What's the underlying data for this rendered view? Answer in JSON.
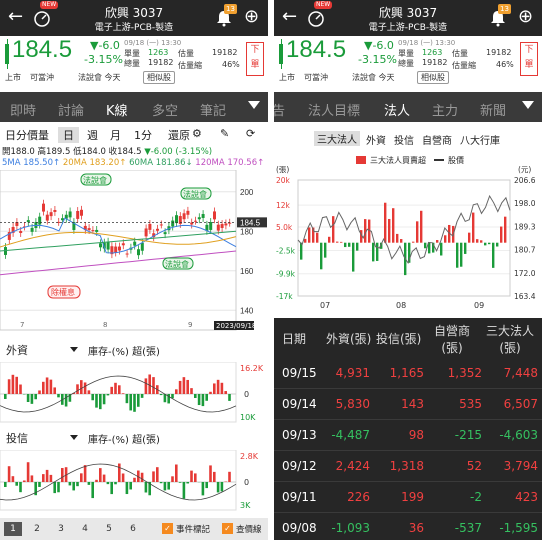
{
  "stock": {
    "name": "欣興 3037",
    "sector": "電子上游-PCB-製造",
    "price": "184.5",
    "change": "▼-6.0",
    "change_pct": "-3.15%",
    "time": "09/18 (一) 13:30",
    "unit_vol_label": "單量",
    "unit_vol": "1263",
    "total_vol_label": "總量",
    "total_vol": "19182",
    "est_vol_label": "估量",
    "est_vol": "19182",
    "est_vol_pct_label": "估量縮",
    "est_vol_pct": "46%",
    "sell_label": "下單",
    "notif_count": "13",
    "new_badge": "NEW"
  },
  "tags": {
    "market": "上市",
    "margin": "可當沖",
    "event": "法說會 今天",
    "similar": "相似股"
  },
  "left": {
    "tabs": [
      "即時",
      "討論",
      "K線",
      "多空",
      "筆記"
    ],
    "period": {
      "days_vol": "日分價量",
      "day": "日",
      "week": "週",
      "month": "月",
      "minute": "1分",
      "restore": "還原"
    },
    "ohlc": {
      "open": "開188.0",
      "high": "高189.5",
      "low": "低184.0",
      "close": "收184.5",
      "chg": "▼-6.00",
      "pct": "(-3.15%)"
    },
    "ma": [
      {
        "label": "5MA 185.50↑",
        "color": "#3d7fe0"
      },
      {
        "label": "20MA 183.20↑",
        "color": "#e0a020"
      },
      {
        "label": "60MA 181.86↓",
        "color": "#30a060"
      },
      {
        "label": "120MA 170.56↑",
        "color": "#c050c0"
      }
    ],
    "price_axis": [
      "200",
      "184.5",
      "180",
      "160",
      "140"
    ],
    "date_axis": [
      "7",
      "8",
      "9",
      "2023/09/18"
    ],
    "annotations": {
      "dividend": "除權息",
      "conf1": "法說會",
      "conf2": "法說會",
      "conf3": "法說會"
    },
    "sub1": {
      "select": "外資",
      "label": "庫存-(%) 超(張)",
      "top": "16.2K",
      "mid": "0",
      "bot": "10K"
    },
    "sub2": {
      "select": "投信",
      "label": "庫存-(%) 超(張)",
      "top": "2.8K",
      "mid": "0",
      "bot": "3K"
    },
    "footer": {
      "pages": [
        "1",
        "2",
        "3",
        "4",
        "5",
        "6"
      ],
      "event_mark": "事件標記",
      "price_line": "查價線"
    }
  },
  "right": {
    "tabs": [
      "告",
      "法人目標",
      "法人",
      "主力",
      "新聞"
    ],
    "subtabs": [
      "三大法人",
      "外資",
      "投信",
      "自營商",
      "八大行庫"
    ],
    "legend": {
      "bar": "三大法人買賣超",
      "line": "股價"
    },
    "units": {
      "left": "(張)",
      "right": "(元)"
    },
    "left_axis": [
      "20k",
      "12k",
      "5.0k",
      "-2.5k",
      "-9.9k",
      "-17k"
    ],
    "right_axis": [
      "206.6",
      "198.0",
      "189.3",
      "180.7",
      "172.0",
      "163.4"
    ],
    "date_axis": [
      "07",
      "08",
      "09"
    ],
    "table": {
      "headers": [
        "日期",
        "外資(張)",
        "投信(張)",
        "自營商\n(張)",
        "三大法人\n(張)"
      ],
      "rows": [
        {
          "date": "09/15",
          "foreign": "4,931",
          "trust": "1,165",
          "dealer": "1,352",
          "total": "7,448"
        },
        {
          "date": "09/14",
          "foreign": "5,830",
          "trust": "143",
          "dealer": "535",
          "total": "6,507"
        },
        {
          "date": "09/13",
          "foreign": "-4,487",
          "trust": "98",
          "dealer": "-215",
          "total": "-4,603"
        },
        {
          "date": "09/12",
          "foreign": "2,424",
          "trust": "1,318",
          "dealer": "52",
          "total": "3,794"
        },
        {
          "date": "09/11",
          "foreign": "226",
          "trust": "199",
          "dealer": "-2",
          "total": "423"
        },
        {
          "date": "09/08",
          "foreign": "-1,093",
          "trust": "36",
          "dealer": "-537",
          "total": "-1,595"
        }
      ]
    }
  }
}
